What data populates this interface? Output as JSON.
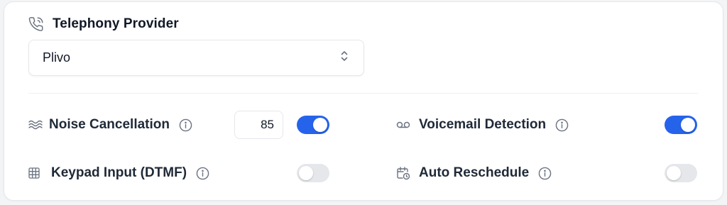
{
  "colors": {
    "accent": "#2563eb",
    "toggle_off": "#e5e7eb"
  },
  "provider": {
    "label": "Telephony Provider",
    "icon": "phone-icon",
    "selected": "Plivo"
  },
  "settings": {
    "noise_cancellation": {
      "label": "Noise Cancellation",
      "icon": "waves-icon",
      "value": "85",
      "enabled": true
    },
    "voicemail_detection": {
      "label": "Voicemail Detection",
      "icon": "voicemail-icon",
      "enabled": true
    },
    "keypad_input": {
      "label": "Keypad Input (DTMF)",
      "icon": "grid-icon",
      "enabled": false
    },
    "auto_reschedule": {
      "label": "Auto Reschedule",
      "icon": "calendar-clock-icon",
      "enabled": false
    }
  }
}
